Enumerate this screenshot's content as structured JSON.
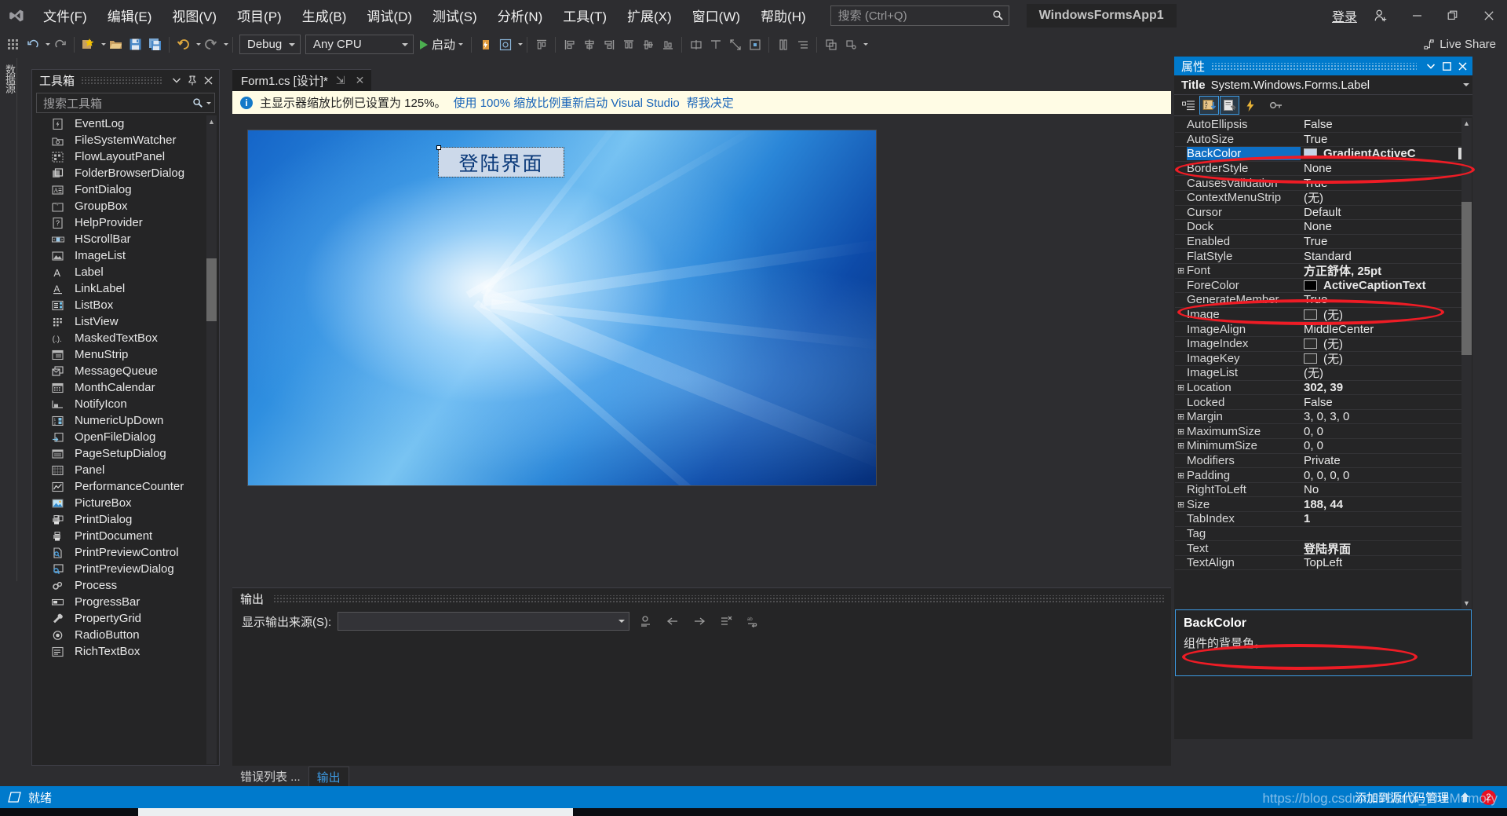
{
  "titlebar": {
    "logo_icon": "visual-studio-logo-icon",
    "menus": [
      {
        "label": "文件(F)"
      },
      {
        "label": "编辑(E)"
      },
      {
        "label": "视图(V)"
      },
      {
        "label": "项目(P)"
      },
      {
        "label": "生成(B)"
      },
      {
        "label": "调试(D)"
      },
      {
        "label": "测试(S)"
      },
      {
        "label": "分析(N)"
      },
      {
        "label": "工具(T)"
      },
      {
        "label": "扩展(X)"
      },
      {
        "label": "窗口(W)"
      },
      {
        "label": "帮助(H)"
      }
    ],
    "search_placeholder": "搜索 (Ctrl+Q)",
    "search_icon": "search-icon",
    "project_chip": "WindowsFormsApp1",
    "signin_label": "登录",
    "signin_icon": "add-user-icon",
    "minimize_icon": "minimize-icon",
    "restore_icon": "restore-icon",
    "close_icon": "close-icon"
  },
  "toolbar": {
    "config_value": "Debug",
    "platform_value": "Any CPU",
    "run_label": "启动",
    "live_share_label": "Live Share",
    "live_share_icon": "live-share-icon"
  },
  "left_dock": {
    "label": "数据源"
  },
  "toolbox": {
    "title": "工具箱",
    "dropdown_icon": "chevron-down-icon",
    "pin_icon": "pin-icon",
    "close_icon": "close-icon",
    "search_placeholder": "搜索工具箱",
    "search_icon": "search-icon",
    "items": [
      {
        "label": "EventLog",
        "icon": "eventlog-icon"
      },
      {
        "label": "FileSystemWatcher",
        "icon": "filesystemwatcher-icon"
      },
      {
        "label": "FlowLayoutPanel",
        "icon": "flowlayoutpanel-icon"
      },
      {
        "label": "FolderBrowserDialog",
        "icon": "folderbrowserdialog-icon"
      },
      {
        "label": "FontDialog",
        "icon": "fontdialog-icon"
      },
      {
        "label": "GroupBox",
        "icon": "groupbox-icon"
      },
      {
        "label": "HelpProvider",
        "icon": "helpprovider-icon"
      },
      {
        "label": "HScrollBar",
        "icon": "hscrollbar-icon"
      },
      {
        "label": "ImageList",
        "icon": "imagelist-icon"
      },
      {
        "label": "Label",
        "icon": "label-icon"
      },
      {
        "label": "LinkLabel",
        "icon": "linklabel-icon"
      },
      {
        "label": "ListBox",
        "icon": "listbox-icon"
      },
      {
        "label": "ListView",
        "icon": "listview-icon"
      },
      {
        "label": "MaskedTextBox",
        "icon": "maskedtextbox-icon"
      },
      {
        "label": "MenuStrip",
        "icon": "menustrip-icon"
      },
      {
        "label": "MessageQueue",
        "icon": "messagequeue-icon"
      },
      {
        "label": "MonthCalendar",
        "icon": "monthcalendar-icon"
      },
      {
        "label": "NotifyIcon",
        "icon": "notifyicon-icon"
      },
      {
        "label": "NumericUpDown",
        "icon": "numericupdown-icon"
      },
      {
        "label": "OpenFileDialog",
        "icon": "openfiledialog-icon"
      },
      {
        "label": "PageSetupDialog",
        "icon": "pagesetupdialog-icon"
      },
      {
        "label": "Panel",
        "icon": "panel-icon"
      },
      {
        "label": "PerformanceCounter",
        "icon": "performancecounter-icon"
      },
      {
        "label": "PictureBox",
        "icon": "picturebox-icon"
      },
      {
        "label": "PrintDialog",
        "icon": "printdialog-icon"
      },
      {
        "label": "PrintDocument",
        "icon": "printdocument-icon"
      },
      {
        "label": "PrintPreviewControl",
        "icon": "printpreviewcontrol-icon"
      },
      {
        "label": "PrintPreviewDialog",
        "icon": "printpreviewdialog-icon"
      },
      {
        "label": "Process",
        "icon": "process-icon"
      },
      {
        "label": "ProgressBar",
        "icon": "progressbar-icon"
      },
      {
        "label": "PropertyGrid",
        "icon": "propertygrid-icon"
      },
      {
        "label": "RadioButton",
        "icon": "radiobutton-icon"
      },
      {
        "label": "RichTextBox",
        "icon": "richtextbox-icon"
      }
    ]
  },
  "document": {
    "tab_label": "Form1.cs [设计]*",
    "tab_pin_icon": "pin-icon",
    "tab_close_icon": "close-icon"
  },
  "infobar": {
    "icon": "info-icon",
    "message": "主显示器缩放比例已设置为 125%。",
    "link": "使用 100% 缩放比例重新启动 Visual Studio",
    "link2": "帮我决定"
  },
  "designer": {
    "label_text": "登陆界面",
    "label_background": "#ccd9ea",
    "form_background_base": "#0a5fbf"
  },
  "output": {
    "title": "输出",
    "source_label": "显示输出来源(S):",
    "source_value": "",
    "buttons": [
      {
        "icon": "find-message-icon"
      },
      {
        "icon": "go-to-previous-icon"
      },
      {
        "icon": "go-to-next-icon"
      },
      {
        "icon": "clear-all-icon"
      },
      {
        "icon": "toggle-word-wrap-icon"
      }
    ]
  },
  "bottom_tabs": [
    {
      "label": "错误列表 ...",
      "active": false
    },
    {
      "label": "输出",
      "active": true
    }
  ],
  "properties": {
    "title": "属性",
    "dropdown_icon": "chevron-down-icon",
    "maximize_icon": "maximize-icon",
    "close_icon": "close-icon",
    "object_label": "Title",
    "object_type": "System.Windows.Forms.Label",
    "object_dropdown_icon": "chevron-down-icon",
    "tool_icons": [
      {
        "icon": "categorized-icon",
        "selected": false
      },
      {
        "icon": "alphabetical-sort-icon",
        "selected": true
      },
      {
        "icon": "properties-page-icon",
        "selected": true
      },
      {
        "icon": "events-lightning-icon",
        "selected": false
      },
      {
        "icon": "property-pages-key-icon",
        "selected": false
      }
    ],
    "rows": [
      {
        "expander": "",
        "name": "AutoEllipsis",
        "value": "False",
        "bold": false,
        "selected": false,
        "swatch": null
      },
      {
        "expander": "",
        "name": "AutoSize",
        "value": "True",
        "bold": false,
        "selected": false,
        "swatch": null
      },
      {
        "expander": "",
        "name": "BackColor",
        "value": "GradientActiveC",
        "bold": true,
        "selected": true,
        "swatch": "#c5d5e8",
        "dropdown": true
      },
      {
        "expander": "",
        "name": "BorderStyle",
        "value": "None",
        "bold": false,
        "selected": false,
        "swatch": null
      },
      {
        "expander": "",
        "name": "CausesValidation",
        "value": "True",
        "bold": false,
        "selected": false,
        "swatch": null
      },
      {
        "expander": "",
        "name": "ContextMenuStrip",
        "value": "(无)",
        "bold": false,
        "selected": false,
        "swatch": null
      },
      {
        "expander": "",
        "name": "Cursor",
        "value": "Default",
        "bold": false,
        "selected": false,
        "swatch": null
      },
      {
        "expander": "",
        "name": "Dock",
        "value": "None",
        "bold": false,
        "selected": false,
        "swatch": null
      },
      {
        "expander": "",
        "name": "Enabled",
        "value": "True",
        "bold": false,
        "selected": false,
        "swatch": null
      },
      {
        "expander": "",
        "name": "FlatStyle",
        "value": "Standard",
        "bold": false,
        "selected": false,
        "swatch": null
      },
      {
        "expander": "⊞",
        "name": "Font",
        "value": "方正舒体, 25pt",
        "bold": true,
        "selected": false,
        "swatch": null
      },
      {
        "expander": "",
        "name": "ForeColor",
        "value": "ActiveCaptionText",
        "bold": true,
        "selected": false,
        "swatch": "#000000"
      },
      {
        "expander": "",
        "name": "GenerateMember",
        "value": "True",
        "bold": false,
        "selected": false,
        "swatch": null
      },
      {
        "expander": "",
        "name": "Image",
        "value": "(无)",
        "bold": false,
        "selected": false,
        "swatch": "#2b2b2b"
      },
      {
        "expander": "",
        "name": "ImageAlign",
        "value": "MiddleCenter",
        "bold": false,
        "selected": false,
        "swatch": null
      },
      {
        "expander": "",
        "name": "ImageIndex",
        "value": "(无)",
        "bold": false,
        "selected": false,
        "swatch": "#2b2b2b"
      },
      {
        "expander": "",
        "name": "ImageKey",
        "value": "(无)",
        "bold": false,
        "selected": false,
        "swatch": "#2b2b2b"
      },
      {
        "expander": "",
        "name": "ImageList",
        "value": "(无)",
        "bold": false,
        "selected": false,
        "swatch": null
      },
      {
        "expander": "⊞",
        "name": "Location",
        "value": "302, 39",
        "bold": true,
        "selected": false,
        "swatch": null
      },
      {
        "expander": "",
        "name": "Locked",
        "value": "False",
        "bold": false,
        "selected": false,
        "swatch": null
      },
      {
        "expander": "⊞",
        "name": "Margin",
        "value": "3, 0, 3, 0",
        "bold": false,
        "selected": false,
        "swatch": null
      },
      {
        "expander": "⊞",
        "name": "MaximumSize",
        "value": "0, 0",
        "bold": false,
        "selected": false,
        "swatch": null
      },
      {
        "expander": "⊞",
        "name": "MinimumSize",
        "value": "0, 0",
        "bold": false,
        "selected": false,
        "swatch": null
      },
      {
        "expander": "",
        "name": "Modifiers",
        "value": "Private",
        "bold": false,
        "selected": false,
        "swatch": null
      },
      {
        "expander": "⊞",
        "name": "Padding",
        "value": "0, 0, 0, 0",
        "bold": false,
        "selected": false,
        "swatch": null
      },
      {
        "expander": "",
        "name": "RightToLeft",
        "value": "No",
        "bold": false,
        "selected": false,
        "swatch": null
      },
      {
        "expander": "⊞",
        "name": "Size",
        "value": "188, 44",
        "bold": true,
        "selected": false,
        "swatch": null
      },
      {
        "expander": "",
        "name": "TabIndex",
        "value": "1",
        "bold": true,
        "selected": false,
        "swatch": null
      },
      {
        "expander": "",
        "name": "Tag",
        "value": "",
        "bold": false,
        "selected": false,
        "swatch": null
      },
      {
        "expander": "",
        "name": "Text",
        "value": "登陆界面",
        "bold": true,
        "selected": false,
        "swatch": null
      },
      {
        "expander": "",
        "name": "TextAlign",
        "value": "TopLeft",
        "bold": false,
        "selected": false,
        "swatch": null
      }
    ],
    "description_title": "BackColor",
    "description_body": "组件的背景色。",
    "annotation_color": "#ee1c25"
  },
  "statusbar": {
    "ready_icon": "ready-icon",
    "ready_label": "就绪",
    "source_control_label": "添加到源代码管理",
    "up_icon": "upload-icon",
    "notification_count": "2",
    "watermark": "https://blog.csdn.net/Blank_TheMemory"
  }
}
